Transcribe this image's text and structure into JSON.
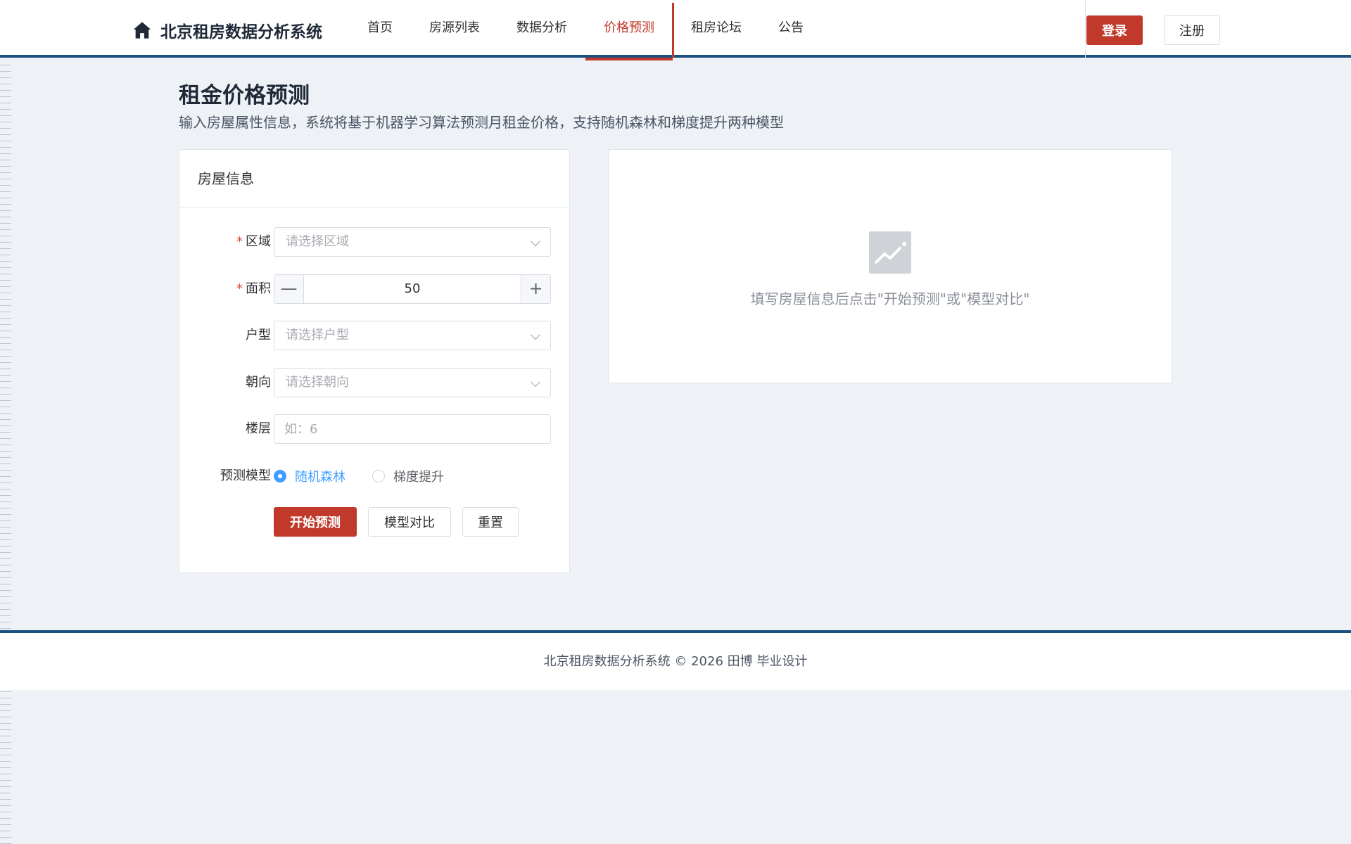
{
  "header": {
    "app_title": "北京租房数据分析系统",
    "nav": [
      {
        "label": "首页"
      },
      {
        "label": "房源列表"
      },
      {
        "label": "数据分析"
      },
      {
        "label": "价格预测"
      },
      {
        "label": "租房论坛"
      },
      {
        "label": "公告"
      }
    ],
    "active_nav": "价格预测",
    "login_label": "登录",
    "register_label": "注册"
  },
  "page": {
    "title": "租金价格预测",
    "subtitle": "输入房屋属性信息，系统将基于机器学习算法预测月租金价格，支持随机森林和梯度提升两种模型"
  },
  "form": {
    "card_title": "房屋信息",
    "district": {
      "label": "区域",
      "required": true,
      "placeholder": "请选择区域"
    },
    "area": {
      "label": "面积",
      "required": true,
      "value": "50",
      "minus": "—",
      "plus": "+"
    },
    "layout": {
      "label": "户型",
      "placeholder": "请选择户型"
    },
    "orientation": {
      "label": "朝向",
      "placeholder": "请选择朝向"
    },
    "floor": {
      "label": "楼层",
      "placeholder": "如：6"
    },
    "model": {
      "label": "预测模型",
      "options": [
        {
          "label": "随机森林",
          "checked": true
        },
        {
          "label": "梯度提升",
          "checked": false
        }
      ]
    },
    "buttons": {
      "predict": "开始预测",
      "compare": "模型对比",
      "reset": "重置"
    }
  },
  "result": {
    "empty_icon": "chart-trend-icon",
    "empty_text": "填写房屋信息后点击\"开始预测\"或\"模型对比\""
  },
  "footer": {
    "text": "北京租房数据分析系统 © 2026 田博 毕业设计"
  },
  "colors": {
    "brand_red": "#c0392b",
    "navy": "#1d4f80",
    "radio_blue": "#409eff"
  }
}
